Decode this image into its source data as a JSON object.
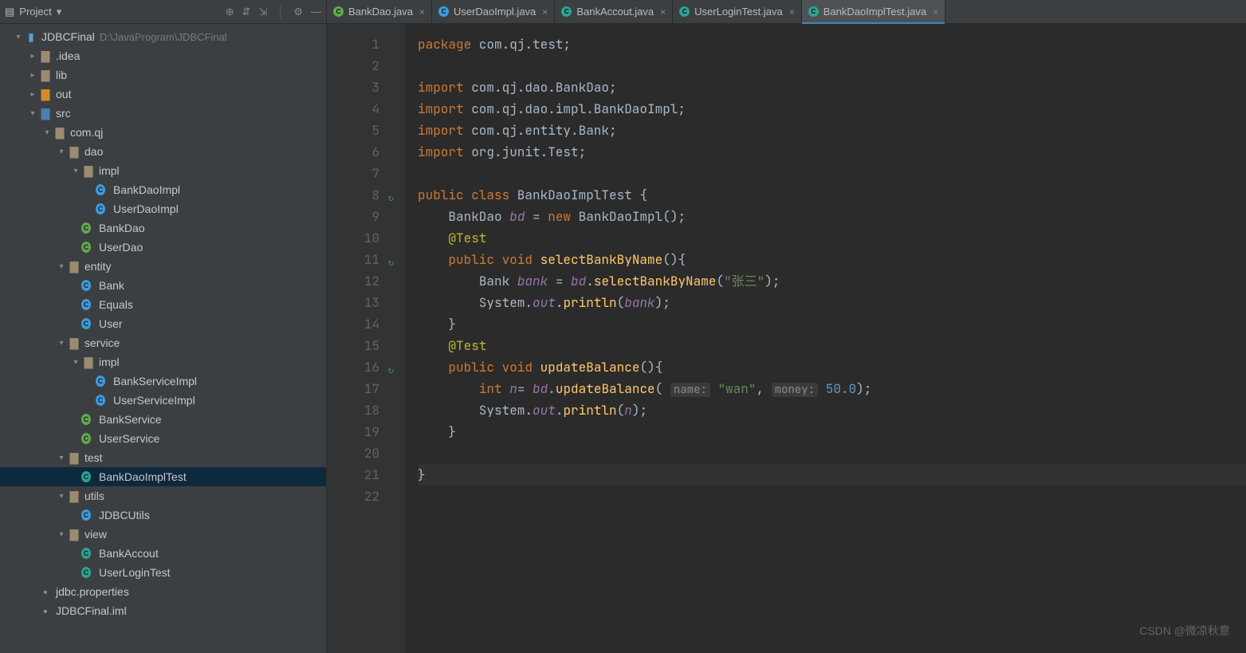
{
  "project_panel": {
    "title": "Project",
    "root": {
      "label": "JDBCFinal",
      "path": "D:\\JavaProgram\\JDBCFinal"
    }
  },
  "toolbar_icons": {
    "target": "target-icon",
    "collapse": "collapse-icon",
    "expand": "expand-icon",
    "settings": "settings-icon",
    "hide": "hide-icon"
  },
  "tree": [
    {
      "depth": 0,
      "icon": "module",
      "label": "JDBCFinal",
      "path": "D:\\JavaProgram\\JDBCFinal",
      "expanded": true
    },
    {
      "depth": 1,
      "icon": "folder",
      "label": ".idea",
      "expanded": false
    },
    {
      "depth": 1,
      "icon": "folder",
      "label": "lib",
      "expanded": false
    },
    {
      "depth": 1,
      "icon": "folder-open",
      "label": "out",
      "expanded": false
    },
    {
      "depth": 1,
      "icon": "folder-blue",
      "label": "src",
      "expanded": true
    },
    {
      "depth": 2,
      "icon": "folder",
      "label": "com.qj",
      "expanded": true
    },
    {
      "depth": 3,
      "icon": "folder",
      "label": "dao",
      "expanded": true
    },
    {
      "depth": 4,
      "icon": "folder",
      "label": "impl",
      "expanded": true
    },
    {
      "depth": 5,
      "icon": "class-blue",
      "label": "BankDaoImpl"
    },
    {
      "depth": 5,
      "icon": "class-blue",
      "label": "UserDaoImpl"
    },
    {
      "depth": 4,
      "icon": "class-green",
      "label": "BankDao"
    },
    {
      "depth": 4,
      "icon": "class-green",
      "label": "UserDao"
    },
    {
      "depth": 3,
      "icon": "folder",
      "label": "entity",
      "expanded": true
    },
    {
      "depth": 4,
      "icon": "class-blue",
      "label": "Bank"
    },
    {
      "depth": 4,
      "icon": "class-blue",
      "label": "Equals"
    },
    {
      "depth": 4,
      "icon": "class-blue",
      "label": "User"
    },
    {
      "depth": 3,
      "icon": "folder",
      "label": "service",
      "expanded": true
    },
    {
      "depth": 4,
      "icon": "folder",
      "label": "impl",
      "expanded": true
    },
    {
      "depth": 5,
      "icon": "class-blue",
      "label": "BankServiceImpl"
    },
    {
      "depth": 5,
      "icon": "class-blue",
      "label": "UserServiceImpl"
    },
    {
      "depth": 4,
      "icon": "class-green",
      "label": "BankService"
    },
    {
      "depth": 4,
      "icon": "class-green",
      "label": "UserService"
    },
    {
      "depth": 3,
      "icon": "folder",
      "label": "test",
      "expanded": true
    },
    {
      "depth": 4,
      "icon": "class-teal",
      "label": "BankDaoImplTest",
      "selected": true
    },
    {
      "depth": 3,
      "icon": "folder",
      "label": "utils",
      "expanded": true
    },
    {
      "depth": 4,
      "icon": "class-blue",
      "label": "JDBCUtils"
    },
    {
      "depth": 3,
      "icon": "folder",
      "label": "view",
      "expanded": true
    },
    {
      "depth": 4,
      "icon": "class-teal",
      "label": "BankAccout"
    },
    {
      "depth": 4,
      "icon": "class-teal",
      "label": "UserLoginTest"
    },
    {
      "depth": 1,
      "icon": "file",
      "label": "jdbc.properties"
    },
    {
      "depth": 1,
      "icon": "file",
      "label": "JDBCFinal.iml"
    }
  ],
  "tabs": [
    {
      "icon": "class-green",
      "label": "BankDao.java",
      "active": false
    },
    {
      "icon": "class-blue",
      "label": "UserDaoImpl.java",
      "active": false
    },
    {
      "icon": "class-teal",
      "label": "BankAccout.java",
      "active": false
    },
    {
      "icon": "class-teal",
      "label": "UserLoginTest.java",
      "active": false
    },
    {
      "icon": "class-teal",
      "label": "BankDaoImplTest.java",
      "active": true
    }
  ],
  "editor": {
    "line_numbers": [
      "1",
      "2",
      "3",
      "4",
      "5",
      "6",
      "7",
      "8",
      "9",
      "10",
      "11",
      "12",
      "13",
      "14",
      "15",
      "16",
      "17",
      "18",
      "19",
      "20",
      "21",
      "22"
    ],
    "gutter_marks": {
      "8": "refresh",
      "11": "refresh",
      "16": "refresh"
    },
    "code": {
      "l1": {
        "t": [
          [
            "kw",
            "package"
          ],
          [
            "pkg",
            " com.qj.test"
          ],
          [
            "p",
            ";"
          ]
        ]
      },
      "l2": {
        "t": []
      },
      "l3": {
        "t": [
          [
            "kw",
            "import"
          ],
          [
            "pkg",
            " com.qj.dao.BankDao"
          ],
          [
            "p",
            ";"
          ]
        ]
      },
      "l4": {
        "t": [
          [
            "kw",
            "import"
          ],
          [
            "pkg",
            " com.qj.dao.impl.BankDaoImpl"
          ],
          [
            "p",
            ";"
          ]
        ]
      },
      "l5": {
        "t": [
          [
            "kw",
            "import"
          ],
          [
            "pkg",
            " com.qj.entity.Bank"
          ],
          [
            "p",
            ";"
          ]
        ]
      },
      "l6": {
        "t": [
          [
            "kw",
            "import"
          ],
          [
            "pkg",
            " org.junit.Test"
          ],
          [
            "p",
            ";"
          ]
        ]
      },
      "l7": {
        "t": []
      },
      "l8": {
        "t": [
          [
            "kw",
            "public class"
          ],
          [
            "cls",
            " BankDaoImplTest "
          ],
          [
            "p",
            "{"
          ]
        ]
      },
      "l9": {
        "t": [
          [
            "p",
            "    "
          ],
          [
            "cls",
            "BankDao "
          ],
          [
            "fld",
            "bd"
          ],
          [
            "p",
            " = "
          ],
          [
            "kw",
            "new"
          ],
          [
            "cls",
            " BankDaoImpl"
          ],
          [
            "p",
            "();"
          ]
        ]
      },
      "l10": {
        "t": [
          [
            "p",
            "    "
          ],
          [
            "ann",
            "@Test"
          ]
        ]
      },
      "l11": {
        "t": [
          [
            "p",
            "    "
          ],
          [
            "kw",
            "public void"
          ],
          [
            "fn",
            " selectBankByName"
          ],
          [
            "p",
            "(){"
          ]
        ]
      },
      "l12": {
        "t": [
          [
            "p",
            "        "
          ],
          [
            "cls",
            "Bank "
          ],
          [
            "fld",
            "bank"
          ],
          [
            "p",
            " = "
          ],
          [
            "fld",
            "bd"
          ],
          [
            "p",
            "."
          ],
          [
            "fn",
            "selectBankByName"
          ],
          [
            "p",
            "("
          ],
          [
            "str",
            "\"张三\""
          ],
          [
            "p",
            ");"
          ]
        ]
      },
      "l13": {
        "t": [
          [
            "p",
            "        System."
          ],
          [
            "fld",
            "out"
          ],
          [
            "p",
            "."
          ],
          [
            "fn",
            "println"
          ],
          [
            "p",
            "("
          ],
          [
            "fld",
            "bank"
          ],
          [
            "p",
            ");"
          ]
        ]
      },
      "l14": {
        "t": [
          [
            "p",
            "    }"
          ]
        ]
      },
      "l15": {
        "t": [
          [
            "p",
            "    "
          ],
          [
            "ann",
            "@Test"
          ]
        ]
      },
      "l16": {
        "t": [
          [
            "p",
            "    "
          ],
          [
            "kw",
            "public void"
          ],
          [
            "fn",
            " updateBalance"
          ],
          [
            "p",
            "(){"
          ]
        ]
      },
      "l17": {
        "t": [
          [
            "p",
            "        "
          ],
          [
            "kw",
            "int"
          ],
          [
            "p",
            " "
          ],
          [
            "fld",
            "n"
          ],
          [
            "p",
            "= "
          ],
          [
            "fld",
            "bd"
          ],
          [
            "p",
            "."
          ],
          [
            "fn",
            "updateBalance"
          ],
          [
            "p",
            "( "
          ],
          [
            "hint",
            "name:"
          ],
          [
            "p",
            " "
          ],
          [
            "str",
            "\"wan\""
          ],
          [
            "p",
            ", "
          ],
          [
            "hint",
            "money:"
          ],
          [
            "p",
            " "
          ],
          [
            "num",
            "50.0"
          ],
          [
            "p",
            ");"
          ]
        ]
      },
      "l18": {
        "t": [
          [
            "p",
            "        System."
          ],
          [
            "fld",
            "out"
          ],
          [
            "p",
            "."
          ],
          [
            "fn",
            "println"
          ],
          [
            "p",
            "("
          ],
          [
            "fld",
            "n"
          ],
          [
            "p",
            ");"
          ]
        ]
      },
      "l19": {
        "t": [
          [
            "p",
            "    }"
          ]
        ]
      },
      "l20": {
        "t": []
      },
      "l21": {
        "t": [
          [
            "p",
            "}"
          ]
        ],
        "current": true
      },
      "l22": {
        "t": []
      }
    }
  },
  "watermark": "CSDN @微凉秋意"
}
